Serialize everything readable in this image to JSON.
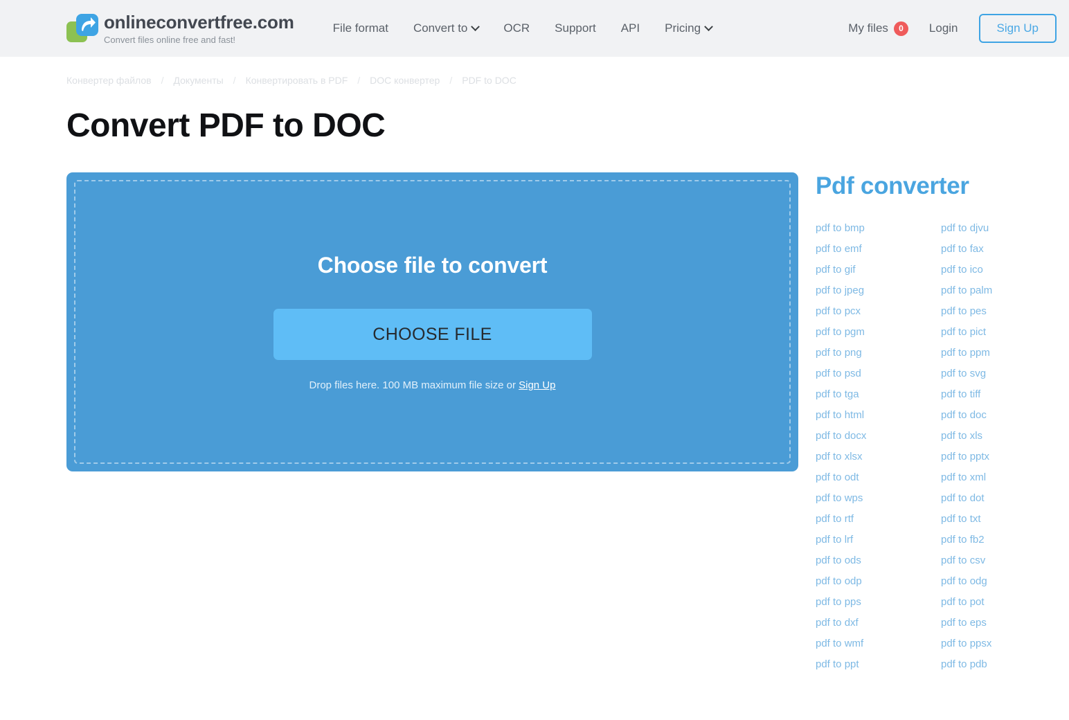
{
  "header": {
    "brand": {
      "title": "onlineconvertfree.com",
      "tagline": "Convert files online free and fast!",
      "logo_icon": "convert-arrow-logo-icon",
      "colors": {
        "green": "#8cc152",
        "blue": "#3ea4e4"
      }
    },
    "nav": [
      {
        "label": "File format",
        "has_chevron": false
      },
      {
        "label": "Convert to",
        "has_chevron": true
      },
      {
        "label": "OCR",
        "has_chevron": false
      },
      {
        "label": "Support",
        "has_chevron": false
      },
      {
        "label": "API",
        "has_chevron": false
      },
      {
        "label": "Pricing",
        "has_chevron": true
      }
    ],
    "my_files": {
      "label": "My files",
      "count": "0",
      "badge_color": "#ef5b5b"
    },
    "login_label": "Login",
    "signup_label": "Sign Up",
    "accent_color": "#3ea4e4",
    "background_color": "#f1f2f4"
  },
  "breadcrumb": {
    "separator": "/",
    "items": [
      "Конвертер файлов",
      "Документы",
      "Конвертировать в PDF",
      "DOC конвертер",
      "PDF to DOC"
    ]
  },
  "page_title": "Convert PDF to DOC",
  "dropzone": {
    "heading": "Choose file to convert",
    "button_label": "CHOOSE FILE",
    "hint_text": "Drop files here. 100 MB maximum file size or ",
    "hint_link": "Sign Up",
    "max_file_size": "100 MB",
    "background_color": "#4a9cd6",
    "button_color": "#5fbdf6"
  },
  "sidebar": {
    "title": "Pdf converter",
    "title_color": "#4aa5e0",
    "link_color": "#7eb9e4",
    "columns": [
      {
        "links": [
          "pdf to bmp",
          "pdf to emf",
          "pdf to gif",
          "pdf to jpeg",
          "pdf to pcx",
          "pdf to pgm",
          "pdf to png",
          "pdf to psd",
          "pdf to tga",
          "pdf to html",
          "pdf to docx",
          "pdf to xlsx",
          "pdf to odt",
          "pdf to wps",
          "pdf to rtf",
          "pdf to lrf",
          "pdf to ods",
          "pdf to odp",
          "pdf to pps",
          "pdf to dxf",
          "pdf to wmf",
          "pdf to ppt"
        ]
      },
      {
        "links": [
          "pdf to djvu",
          "pdf to fax",
          "pdf to ico",
          "pdf to palm",
          "pdf to pes",
          "pdf to pict",
          "pdf to ppm",
          "pdf to svg",
          "pdf to tiff",
          "pdf to doc",
          "pdf to xls",
          "pdf to pptx",
          "pdf to xml",
          "pdf to dot",
          "pdf to txt",
          "pdf to fb2",
          "pdf to csv",
          "pdf to odg",
          "pdf to pot",
          "pdf to eps",
          "pdf to ppsx",
          "pdf to pdb"
        ]
      }
    ]
  }
}
